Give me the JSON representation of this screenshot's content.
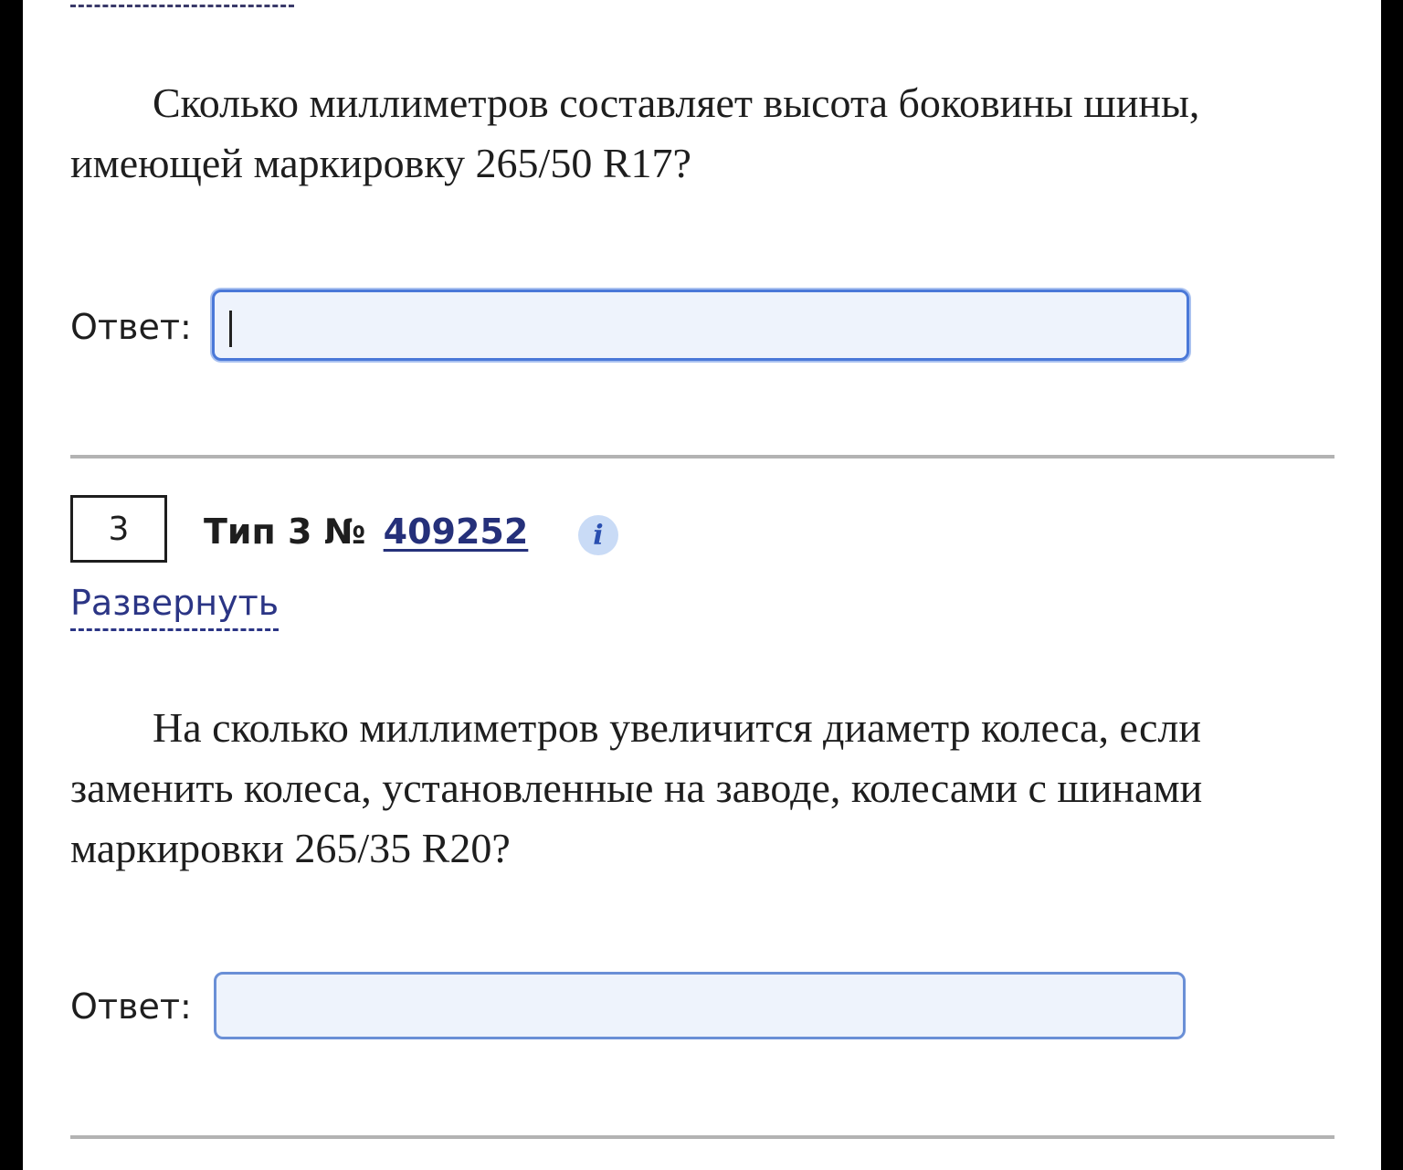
{
  "question_2": {
    "text": "Сколько миллиметров составляет высота боковины шины, имеющей маркировку 265/50 R17?",
    "answer_label": "Ответ:",
    "answer_value": ""
  },
  "task_3": {
    "number": "3",
    "type_label": "Тип 3 №",
    "task_id": "409252",
    "info_icon": "i",
    "expand_label": "Развернуть",
    "text": "На сколько миллиметров увеличится диаметр колеса, если заменить колеса, установленные на заводе, колесами с шинами маркировки 265/35 R20?",
    "answer_label": "Ответ:",
    "answer_value": ""
  },
  "colors": {
    "link": "#25307a",
    "input_border_focused": "#4a78d8",
    "input_background": "#eef3fc",
    "divider": "#b3b3b3"
  }
}
